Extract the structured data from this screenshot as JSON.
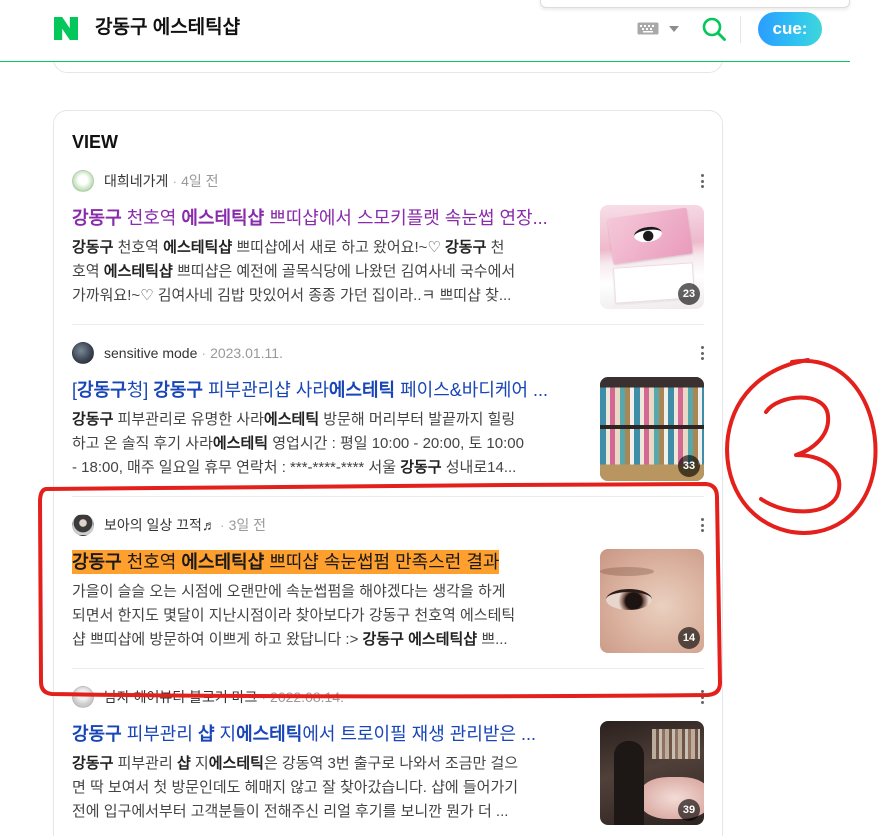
{
  "header": {
    "logo_text": "N",
    "query": "강동구 에스테틱샵",
    "cue_label": "cue:",
    "icons": {
      "logo": "naver-logo-icon",
      "keyboard": "keyboard-icon",
      "dropdown": "chevron-down-icon",
      "search": "search-icon"
    }
  },
  "view": {
    "title": "VIEW",
    "separator": "·",
    "items": [
      {
        "author": "대희네가게",
        "date": "4일 전",
        "title_color": "#8a2bab",
        "title": [
          "강동구",
          " 천호역 ",
          "에스테틱샵",
          " 쁘띠샵에서 스모키플랫 속눈썹 연장..."
        ],
        "description": [
          [
            "강동구",
            " 천호역 ",
            "에스테틱샵",
            " 쁘띠샵에서 새로 하고 왔어요!~♡ ",
            "강동구",
            " 천"
          ],
          [
            "호역 ",
            "에스테틱샵",
            " 쁘띠샵은 예전에 골목식당에 나왔던 김여사네 국수에서"
          ],
          [
            "가까워요!~♡ 김여사네 김밥 맛있어서 종종 가던 집이라..ㅋ 쁘띠샵 찾..."
          ]
        ],
        "image_count": "23"
      },
      {
        "author": "sensitive mode",
        "date": "2023.01.11.",
        "title_color": "#1846b7",
        "title": [
          "[",
          "강동구",
          "청] ",
          "강동구",
          " 피부관리샵 사라",
          "에스테틱",
          " 페이스&바디케어 ..."
        ],
        "description": [
          [
            "강동구",
            " 피부관리로 유명한 사라",
            "에스테틱",
            " 방문해 머리부터 발끝까지 힐링"
          ],
          [
            "하고 온 솔직 후기 사라",
            "에스테틱",
            " 영업시간 : 평일 10:00 - 20:00, 토 10:00"
          ],
          [
            "- 18:00, 매주 일요일 휴무 연락처 : ***-****-**** 서울 ",
            "강동구",
            " 성내로14..."
          ]
        ],
        "image_count": "33"
      },
      {
        "author": "보아의 일상 끄적♬",
        "date": "3일 전",
        "title_color": "#1a1a1a",
        "highlight_color": "#ff9f2e",
        "title": [
          "강동구",
          " 천호역 ",
          "에스테틱샵",
          " 쁘띠샵 속눈썹펌 만족스런 결과"
        ],
        "description": [
          [
            "가을이 슬슬 오는 시점에 오랜만에 속눈썹펌을 해야겠다는 생각을 하게"
          ],
          [
            "되면서 한지도 몇달이 지난시점이라 찾아보다가 강동구 천호역 에스테틱"
          ],
          [
            "샵 쁘띠샵에 방문하여 이쁘게 하고 왔답니다 :> ",
            "강동구",
            " ",
            "에스테틱샵",
            " 쁘..."
          ]
        ],
        "image_count": "14"
      },
      {
        "author": "남자 헤어뷰티 블로거 마크",
        "date": "2022.08.14.",
        "title_color": "#1846b7",
        "title": [
          "강동구",
          " 피부관리 ",
          "샵",
          " 지",
          "에스테틱",
          "에서 트로이필 재생 관리받은 ..."
        ],
        "description": [
          [
            "강동구",
            " 피부관리 ",
            "샵",
            " 지",
            "에스테틱",
            "은 강동역 3번 출구로 나와서 조금만 걸으"
          ],
          [
            "면 딱 보여서 첫 방문인데도 헤매지 않고 잘 찾아갔습니다. 샵에 들어가기"
          ],
          [
            "전에 입구에서부터 고객분들이 전해주신 리얼 후기를 보니깐 뭔가 더 ..."
          ]
        ],
        "image_count": "39"
      }
    ]
  },
  "colors": {
    "brand": "#03c75a",
    "visited_title": "#8a2bab",
    "link_title": "#1846b7",
    "highlight": "#ff9f2e",
    "cue_gradient": [
      "#2b9cff",
      "#3ed6da"
    ]
  },
  "annotation": {
    "number": "3",
    "color": "#e3201b"
  }
}
